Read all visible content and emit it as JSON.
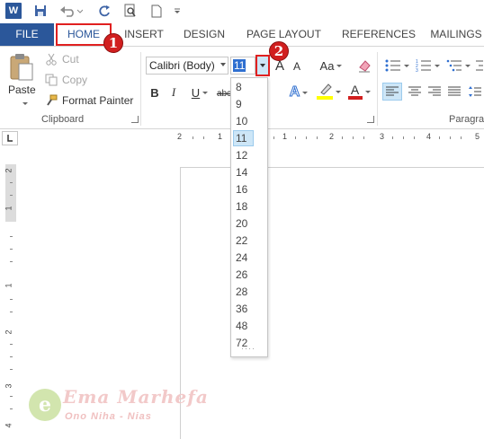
{
  "qat": {
    "app_icon": "W",
    "icons": [
      "word-logo-icon",
      "save-icon",
      "undo-icon",
      "redo-icon",
      "print-preview-icon",
      "new-document-icon",
      "customize-qat-icon"
    ]
  },
  "tabs": {
    "file": "FILE",
    "home": "HOME",
    "insert": "INSERT",
    "design": "DESIGN",
    "page_layout": "PAGE LAYOUT",
    "references": "REFERENCES",
    "mailings": "MAILINGS"
  },
  "clipboard": {
    "paste": "Paste",
    "cut": "Cut",
    "copy": "Copy",
    "format_painter": "Format Painter",
    "group_label": "Clipboard"
  },
  "font": {
    "font_name": "Calibri (Body)",
    "font_size": "11",
    "size_options": [
      "8",
      "9",
      "10",
      "11",
      "12",
      "14",
      "16",
      "18",
      "20",
      "22",
      "24",
      "26",
      "28",
      "36",
      "48",
      "72"
    ],
    "selected_size": "11",
    "bold": "B",
    "italic": "I",
    "underline": "U",
    "strikethrough": "abc",
    "grow": "A",
    "shrink": "A",
    "change_case": "Aa",
    "text_effects": "A",
    "font_color": "A"
  },
  "paragraph": {
    "group_label": "Paragra"
  },
  "ruler": {
    "h_numbers": [
      "2",
      "1",
      "1",
      "2",
      "3",
      "4",
      "5"
    ],
    "v_numbers": [
      "2",
      "1",
      "1",
      "2",
      "3",
      "4"
    ]
  },
  "callouts": {
    "one": "1",
    "two": "2"
  },
  "watermark": {
    "letter": "e",
    "title": "Ema Marhefa",
    "subtitle": "Ono Niha - Nias"
  },
  "colors": {
    "file_tab": "#2b579a",
    "callout": "#d11f1f",
    "highlight": "#ffff00",
    "font_color_bar": "#d11f1f",
    "selected_item": "#cde6f7"
  }
}
